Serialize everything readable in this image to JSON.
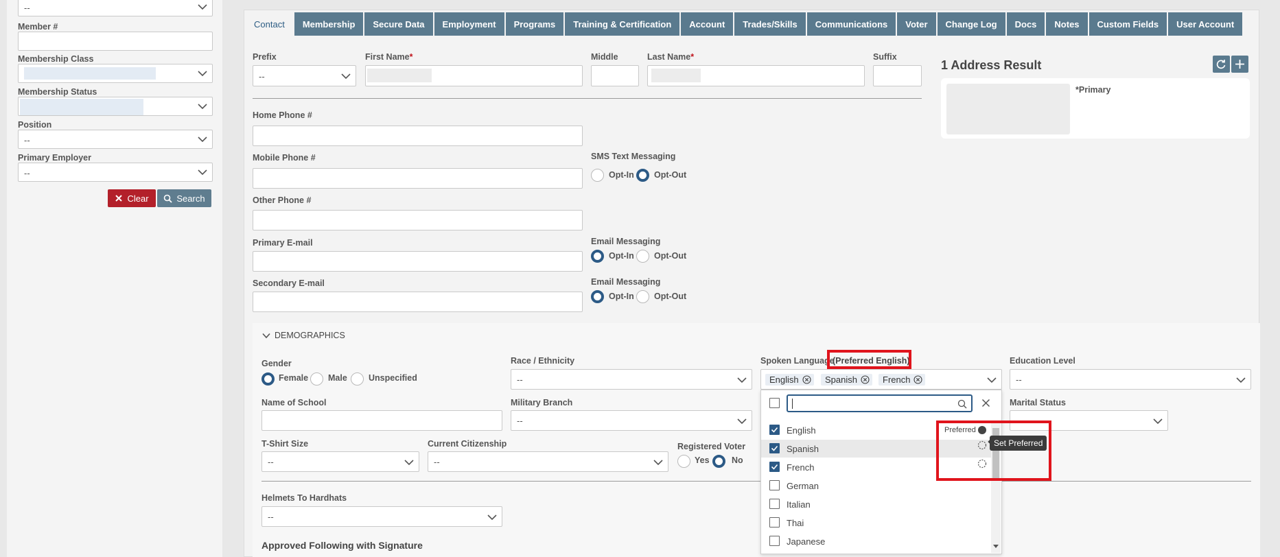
{
  "search_panel": {
    "top_select_value": "--",
    "member_no_label": "Member #",
    "membership_class_label": "Membership Class",
    "membership_status_label": "Membership Status",
    "position_label": "Position",
    "position_value": "--",
    "primary_employer_label": "Primary Employer",
    "primary_employer_value": "--",
    "clear_label": "Clear",
    "search_label": "Search"
  },
  "tabs": [
    "Contact",
    "Membership",
    "Secure Data",
    "Employment",
    "Programs",
    "Training & Certification",
    "Account",
    "Trades/Skills",
    "Communications",
    "Voter",
    "Change Log",
    "Docs",
    "Notes",
    "Custom Fields",
    "User Account"
  ],
  "contact": {
    "prefix_label": "Prefix",
    "prefix_value": "--",
    "first_name_label": "First Name",
    "middle_label": "Middle",
    "last_name_label": "Last Name",
    "suffix_label": "Suffix",
    "required_mark": "*",
    "home_phone_label": "Home Phone #",
    "mobile_phone_label": "Mobile Phone #",
    "other_phone_label": "Other Phone #",
    "primary_email_label": "Primary E-mail",
    "secondary_email_label": "Secondary E-mail",
    "sms_label": "SMS Text Messaging",
    "email_messaging_label": "Email Messaging",
    "opt_in": "Opt-In",
    "opt_out": "Opt-Out"
  },
  "address": {
    "title": "1 Address Result",
    "primary_tag": "*Primary"
  },
  "demographics": {
    "section_title": "DEMOGRAPHICS",
    "gender_label": "Gender",
    "gender_female": "Female",
    "gender_male": "Male",
    "gender_unspecified": "Unspecified",
    "race_label": "Race / Ethnicity",
    "race_value": "--",
    "spoken_language_label": "Spoken Language",
    "preferred_note": "(Preferred English)",
    "selected_languages": [
      "English",
      "Spanish",
      "French"
    ],
    "education_label": "Education Level",
    "education_value": "--",
    "school_label": "Name of School",
    "military_label": "Military Branch",
    "military_value": "--",
    "marital_label": "Marital Status",
    "tshirt_label": "T-Shirt Size",
    "tshirt_value": "--",
    "citizenship_label": "Current Citizenship",
    "citizenship_value": "--",
    "registered_voter_label": "Registered Voter",
    "yes": "Yes",
    "no": "No",
    "helmets_label": "Helmets To Hardhats",
    "helmets_value": "--",
    "approved_label": "Approved Following with Signature"
  },
  "language_dropdown": {
    "search_value": "",
    "options": [
      {
        "label": "English",
        "checked": true,
        "preferred": true
      },
      {
        "label": "Spanish",
        "checked": true,
        "preferred": false
      },
      {
        "label": "French",
        "checked": true,
        "preferred": false
      },
      {
        "label": "German",
        "checked": false,
        "preferred": false
      },
      {
        "label": "Italian",
        "checked": false,
        "preferred": false
      },
      {
        "label": "Thai",
        "checked": false,
        "preferred": false
      },
      {
        "label": "Japanese",
        "checked": false,
        "preferred": false
      }
    ],
    "preferred_text": "Preferred",
    "tooltip": "Set Preferred"
  },
  "colors": {
    "tab_bg": "#5a7a8e",
    "accent": "#2c5a86",
    "clear_button": "#b3202a",
    "highlight_box": "#e0141c"
  }
}
